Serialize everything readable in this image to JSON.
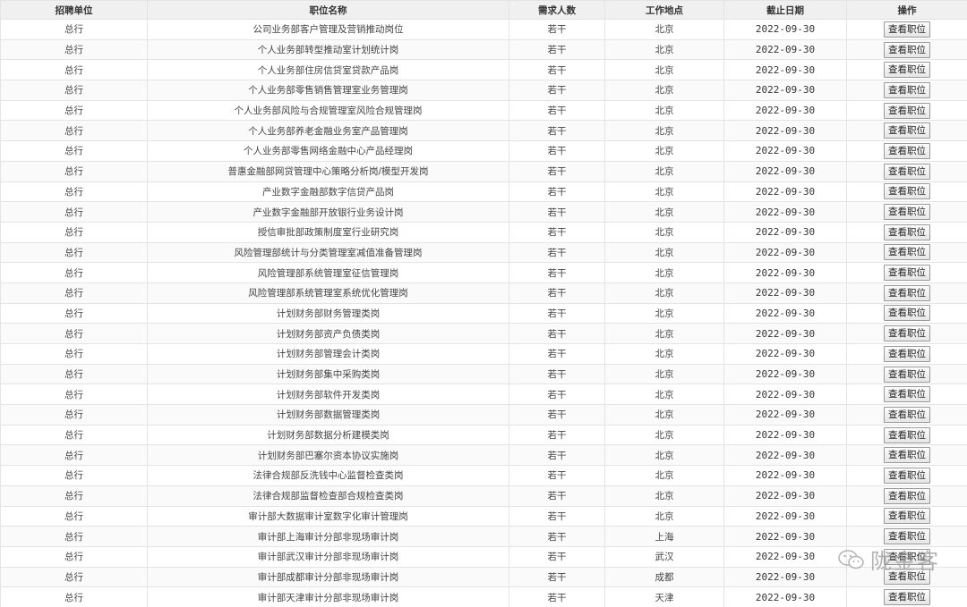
{
  "table": {
    "headers": [
      "招聘单位",
      "职位名称",
      "需求人数",
      "工作地点",
      "截止日期",
      "操作"
    ],
    "action_label": "查看职位",
    "rows": [
      {
        "unit": "总行",
        "title": "公司业务部客户管理及营销推动岗位",
        "count": "若干",
        "location": "北京",
        "deadline": "2022-09-30"
      },
      {
        "unit": "总行",
        "title": "个人业务部转型推动室计划统计岗",
        "count": "若干",
        "location": "北京",
        "deadline": "2022-09-30"
      },
      {
        "unit": "总行",
        "title": "个人业务部住房信贷室贷款产品岗",
        "count": "若干",
        "location": "北京",
        "deadline": "2022-09-30"
      },
      {
        "unit": "总行",
        "title": "个人业务部零售销售管理室业务管理岗",
        "count": "若干",
        "location": "北京",
        "deadline": "2022-09-30"
      },
      {
        "unit": "总行",
        "title": "个人业务部风险与合规管理室风险合规管理岗",
        "count": "若干",
        "location": "北京",
        "deadline": "2022-09-30"
      },
      {
        "unit": "总行",
        "title": "个人业务部养老金融业务室产品管理岗",
        "count": "若干",
        "location": "北京",
        "deadline": "2022-09-30"
      },
      {
        "unit": "总行",
        "title": "个人业务部零售网络金融中心产品经理岗",
        "count": "若干",
        "location": "北京",
        "deadline": "2022-09-30"
      },
      {
        "unit": "总行",
        "title": "普惠金融部网贷管理中心策略分析岗/模型开发岗",
        "count": "若干",
        "location": "北京",
        "deadline": "2022-09-30"
      },
      {
        "unit": "总行",
        "title": "产业数字金融部数字信贷产品岗",
        "count": "若干",
        "location": "北京",
        "deadline": "2022-09-30"
      },
      {
        "unit": "总行",
        "title": "产业数字金融部开放银行业务设计岗",
        "count": "若干",
        "location": "北京",
        "deadline": "2022-09-30"
      },
      {
        "unit": "总行",
        "title": "授信审批部政策制度室行业研究岗",
        "count": "若干",
        "location": "北京",
        "deadline": "2022-09-30"
      },
      {
        "unit": "总行",
        "title": "风险管理部统计与分类管理室减值准备管理岗",
        "count": "若干",
        "location": "北京",
        "deadline": "2022-09-30"
      },
      {
        "unit": "总行",
        "title": "风险管理部系统管理室征信管理岗",
        "count": "若干",
        "location": "北京",
        "deadline": "2022-09-30"
      },
      {
        "unit": "总行",
        "title": "风险管理部系统管理室系统优化管理岗",
        "count": "若干",
        "location": "北京",
        "deadline": "2022-09-30"
      },
      {
        "unit": "总行",
        "title": "计划财务部财务管理类岗",
        "count": "若干",
        "location": "北京",
        "deadline": "2022-09-30"
      },
      {
        "unit": "总行",
        "title": "计划财务部资产负债类岗",
        "count": "若干",
        "location": "北京",
        "deadline": "2022-09-30"
      },
      {
        "unit": "总行",
        "title": "计划财务部管理会计类岗",
        "count": "若干",
        "location": "北京",
        "deadline": "2022-09-30"
      },
      {
        "unit": "总行",
        "title": "计划财务部集中采购类岗",
        "count": "若干",
        "location": "北京",
        "deadline": "2022-09-30"
      },
      {
        "unit": "总行",
        "title": "计划财务部软件开发类岗",
        "count": "若干",
        "location": "北京",
        "deadline": "2022-09-30"
      },
      {
        "unit": "总行",
        "title": "计划财务部数据管理类岗",
        "count": "若干",
        "location": "北京",
        "deadline": "2022-09-30"
      },
      {
        "unit": "总行",
        "title": "计划财务部数据分析建模类岗",
        "count": "若干",
        "location": "北京",
        "deadline": "2022-09-30"
      },
      {
        "unit": "总行",
        "title": "计划财务部巴塞尔资本协议实施岗",
        "count": "若干",
        "location": "北京",
        "deadline": "2022-09-30"
      },
      {
        "unit": "总行",
        "title": "法律合规部反洗钱中心监督检查类岗",
        "count": "若干",
        "location": "北京",
        "deadline": "2022-09-30"
      },
      {
        "unit": "总行",
        "title": "法律合规部监督检查部合规检查类岗",
        "count": "若干",
        "location": "北京",
        "deadline": "2022-09-30"
      },
      {
        "unit": "总行",
        "title": "审计部大数据审计室数字化审计管理岗",
        "count": "若干",
        "location": "北京",
        "deadline": "2022-09-30"
      },
      {
        "unit": "总行",
        "title": "审计部上海审计分部非现场审计岗",
        "count": "若干",
        "location": "上海",
        "deadline": "2022-09-30"
      },
      {
        "unit": "总行",
        "title": "审计部武汉审计分部非现场审计岗",
        "count": "若干",
        "location": "武汉",
        "deadline": "2022-09-30"
      },
      {
        "unit": "总行",
        "title": "审计部成都审计分部非现场审计岗",
        "count": "若干",
        "location": "成都",
        "deadline": "2022-09-30"
      },
      {
        "unit": "总行",
        "title": "审计部天津审计分部非现场审计岗",
        "count": "若干",
        "location": "天津",
        "deadline": "2022-09-30"
      }
    ]
  },
  "watermark": {
    "text": "陇金客",
    "icon": "wechat-icon"
  }
}
